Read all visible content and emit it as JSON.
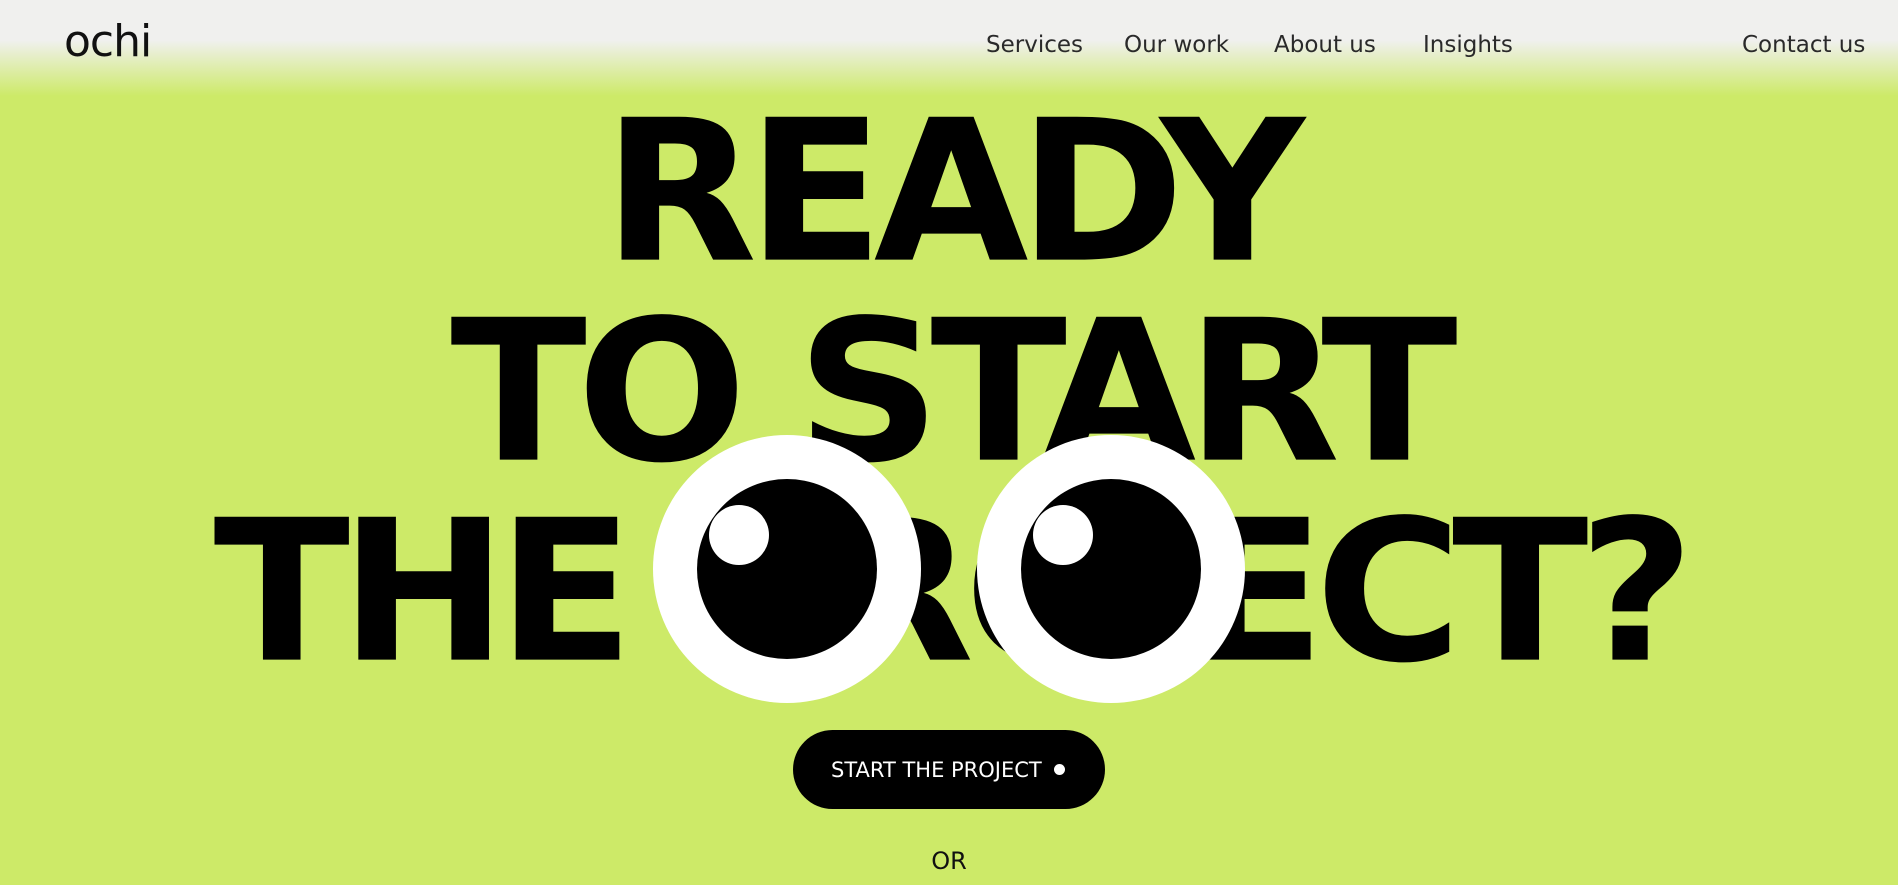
{
  "brand": {
    "logo_text": "ochi"
  },
  "nav": {
    "links": [
      "Services",
      "Our work",
      "About us",
      "Insights"
    ],
    "contact": "Contact us"
  },
  "hero": {
    "line1": "READY",
    "line2": "TO START",
    "line3": "THE PROJECT?"
  },
  "cta": {
    "label": "START THE PROJECT"
  },
  "divider_text": "OR",
  "colors": {
    "background": "#cdea68",
    "text": "#000000",
    "button": "#000000",
    "eye_white": "#ffffff"
  }
}
